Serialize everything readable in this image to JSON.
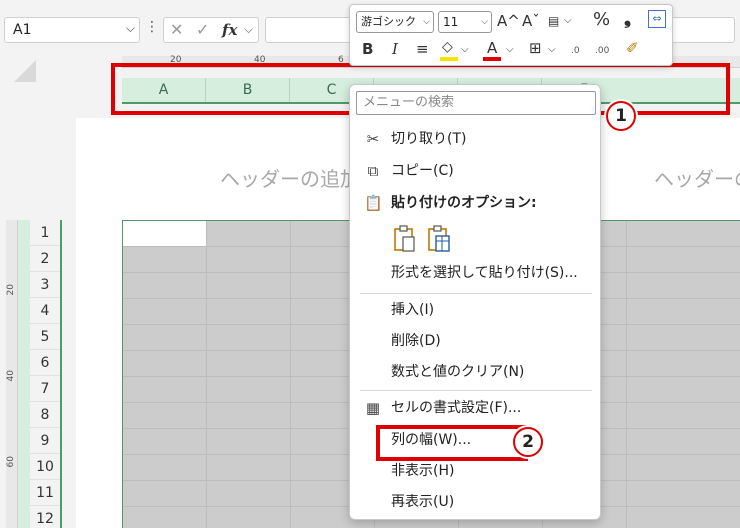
{
  "name_box": {
    "value": "A1"
  },
  "formula_bar": {
    "fx_label": "fx",
    "cancel_glyph": "✕",
    "enter_glyph": "✓"
  },
  "ruler_top": {
    "labels": [
      "20",
      "40",
      "6"
    ]
  },
  "ruler_left": {
    "labels": [
      "20",
      "40",
      "60"
    ]
  },
  "columns": [
    {
      "label": "A"
    },
    {
      "label": "B"
    },
    {
      "label": "C"
    },
    {
      "label": "F"
    }
  ],
  "rows": [
    "1",
    "2",
    "3",
    "4",
    "5",
    "6",
    "7",
    "8",
    "9",
    "10",
    "11",
    "12"
  ],
  "page": {
    "header_hint_left": "ヘッダーの追加",
    "header_hint_right": "ヘッダーの"
  },
  "mini_toolbar": {
    "font_name": "游ゴシック",
    "font_size": "11",
    "increase_font": "A^",
    "decrease_font": "Aˇ",
    "percent": "%",
    "comma": "❟",
    "bold": "B",
    "italic": "I",
    "align": "≡",
    "font_color_label": "A",
    "decimal_increase": ".0",
    "decimal_decrease": ".00",
    "fill_color": "#f7e300",
    "font_color": "#e00000"
  },
  "context_menu": {
    "search_placeholder": "メニューの検索",
    "items": {
      "cut": "切り取り(T)",
      "copy": "コピー(C)",
      "paste_options": "貼り付けのオプション:",
      "paste_special": "形式を選択して貼り付け(S)...",
      "insert": "挿入(I)",
      "delete": "削除(D)",
      "clear_contents": "数式と値のクリア(N)",
      "format_cells": "セルの書式設定(F)...",
      "column_width": "列の幅(W)...",
      "hide": "非表示(H)",
      "unhide": "再表示(U)"
    }
  },
  "annotations": {
    "badge_1": "1",
    "badge_2": "2",
    "color": "#e00000"
  }
}
